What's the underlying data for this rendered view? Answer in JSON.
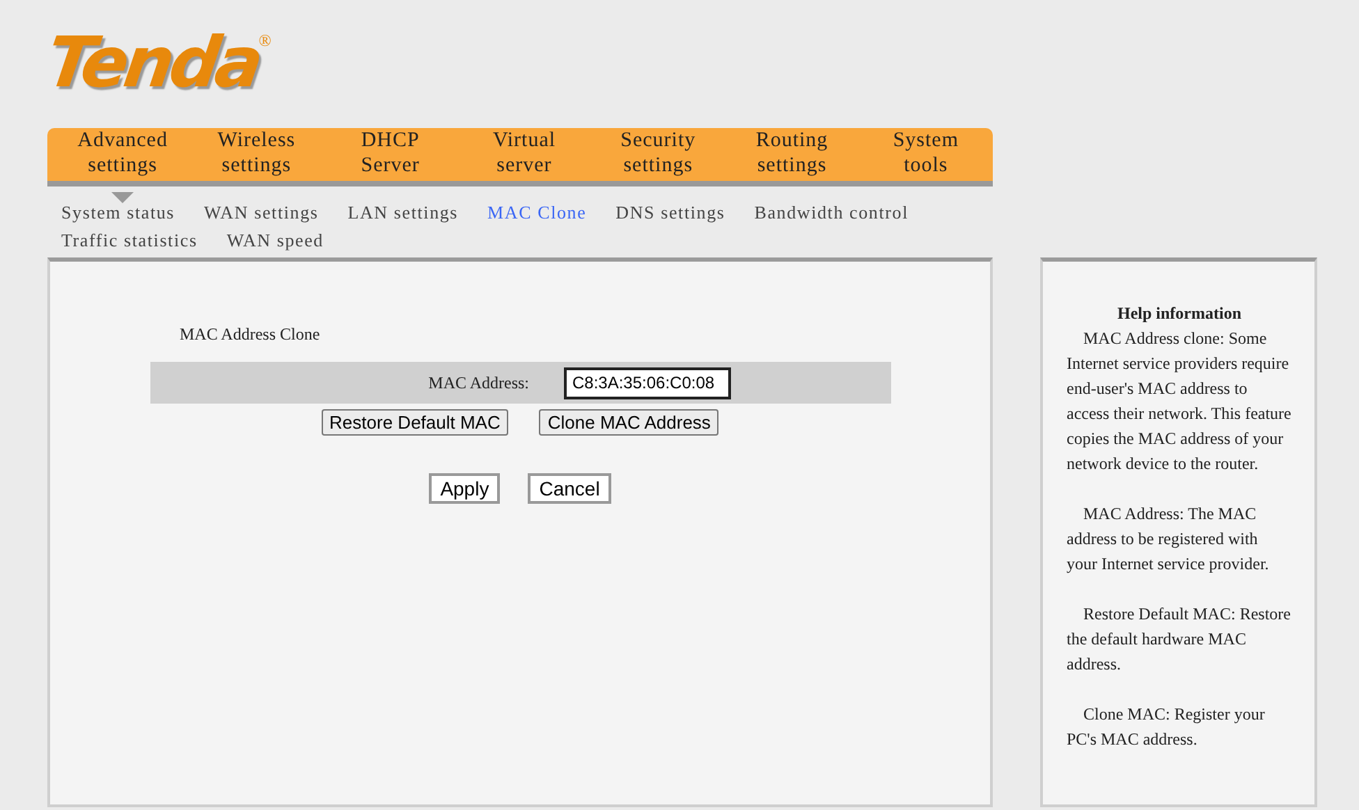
{
  "logo": {
    "text": "Tenda",
    "mark": "®"
  },
  "main_tabs": [
    {
      "label": "Advanced settings",
      "selected": true
    },
    {
      "label": "Wireless settings",
      "selected": false
    },
    {
      "label": "DHCP Server",
      "selected": false
    },
    {
      "label": "Virtual server",
      "selected": false
    },
    {
      "label": "Security settings",
      "selected": false
    },
    {
      "label": "Routing settings",
      "selected": false
    },
    {
      "label": "System tools",
      "selected": false
    }
  ],
  "sub_tabs": [
    {
      "label": "System status",
      "selected": false
    },
    {
      "label": "WAN settings",
      "selected": false
    },
    {
      "label": "LAN settings",
      "selected": false
    },
    {
      "label": "MAC Clone",
      "selected": true
    },
    {
      "label": "DNS settings",
      "selected": false
    },
    {
      "label": "Bandwidth control",
      "selected": false
    },
    {
      "label": "Traffic statistics",
      "selected": false
    },
    {
      "label": "WAN speed",
      "selected": false
    }
  ],
  "form": {
    "title": "MAC Address Clone",
    "field_label": "MAC Address:",
    "value": "C8:3A:35:06:C0:08",
    "buttons": [
      "Restore Default MAC",
      "Clone MAC Address"
    ],
    "actions": [
      "Apply",
      "Cancel"
    ]
  },
  "help": {
    "title": "Help information",
    "paragraphs": [
      "MAC Address clone: Some Internet service providers require end-user's MAC address to access their network. This feature copies the MAC address of your network device to the router.",
      "MAC Address: The MAC address to be registered with your Internet service provider.",
      "Restore Default MAC: Restore the default hardware MAC address.",
      "Clone MAC: Register your PC's MAC address."
    ]
  }
}
